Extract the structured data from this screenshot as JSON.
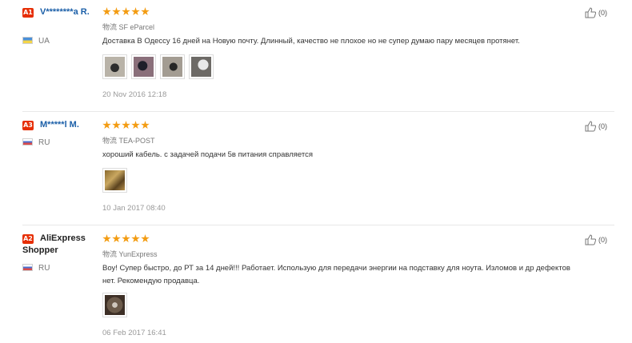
{
  "shipping_prefix": "物流",
  "reviews": [
    {
      "badge": "A1",
      "name": "V********a R.",
      "country": "UA",
      "rating": 5,
      "shipping": "SF eParcel",
      "text": "Доставка В Одессу 16 дней на Новую почту. Длинный, качество не плохое но не супер думаю пару месяцев протянет.",
      "photos": [
        "photo-1",
        "photo-2",
        "photo-3",
        "photo-4"
      ],
      "date": "20 Nov 2016 12:18",
      "helpful_count": "(0)"
    },
    {
      "badge": "A3",
      "name": "M*****l M.",
      "country": "RU",
      "rating": 5,
      "shipping": "TEA-POST",
      "text": "хороший кабель. с задачей подачи 5в питания справляется",
      "photos": [
        "photo-1"
      ],
      "date": "10 Jan 2017 08:40",
      "helpful_count": "(0)"
    },
    {
      "badge": "A2",
      "name": "AliExpress Shopper",
      "country": "RU",
      "rating": 5,
      "shipping": "YunExpress",
      "text": "Воу! Супер быстро, до РТ за 14 дней!!! Работает. Использую для передачи энергии на подставку для ноута. Изломов и др дефектов нет. Рекомендую продавца.",
      "photos": [
        "photo-1"
      ],
      "date": "06 Feb 2017 16:41",
      "helpful_count": "(0)"
    }
  ]
}
